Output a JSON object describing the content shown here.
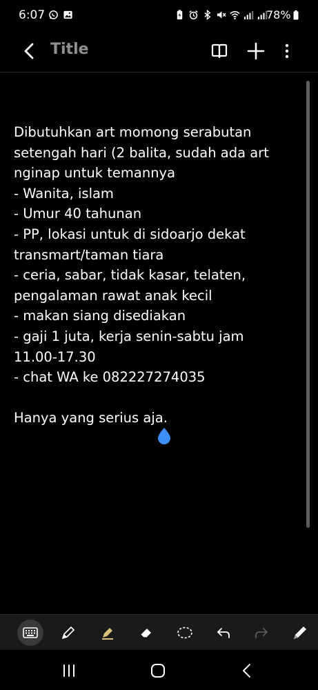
{
  "status_bar": {
    "time": "6:07",
    "battery": "78%",
    "left_icons": [
      "whatsapp-icon",
      "gallery-icon"
    ],
    "right_icons": [
      "battery-saver-icon",
      "alarm-icon",
      "bluetooth-icon",
      "mute-icon",
      "wifi-icon",
      "signal-icon",
      "signal-icon"
    ]
  },
  "app_bar": {
    "title": "Title",
    "buttons": [
      "back-icon",
      "book-icon",
      "add-icon",
      "more-icon"
    ]
  },
  "note": {
    "body": "Dibutuhkan art momong serabutan\nsetengah hari (2 balita, sudah ada art\nnginap untuk temannya\n- Wanita, islam\n- Umur 40 tahunan\n- PP, lokasi untuk di sidoarjo dekat\ntransmart/taman tiara\n- ceria, sabar, tidak kasar, telaten,\npengalaman rawat anak kecil\n- makan siang disediakan\n- gaji 1 juta, kerja senin-sabtu jam\n11.00-17.30\n- chat WA ke 082227274035\n\nHanya yang serius aja."
  },
  "toolbar": {
    "tools": [
      "keyboard-icon",
      "pen-icon",
      "highlighter-icon",
      "eraser-icon",
      "lasso-icon",
      "undo-icon",
      "redo-icon",
      "pen-settings-icon"
    ],
    "active_tool": "keyboard-icon"
  },
  "nav_bar": {
    "buttons": [
      "recent-apps-icon",
      "home-icon",
      "back-nav-icon"
    ]
  },
  "colors": {
    "background": "#000000",
    "text": "#ffffff",
    "title": "#8f8f8f",
    "toolbar": "#1a1a1a",
    "cursor_handle": "#3d8ef7",
    "highlighter": "#d8c27a"
  }
}
